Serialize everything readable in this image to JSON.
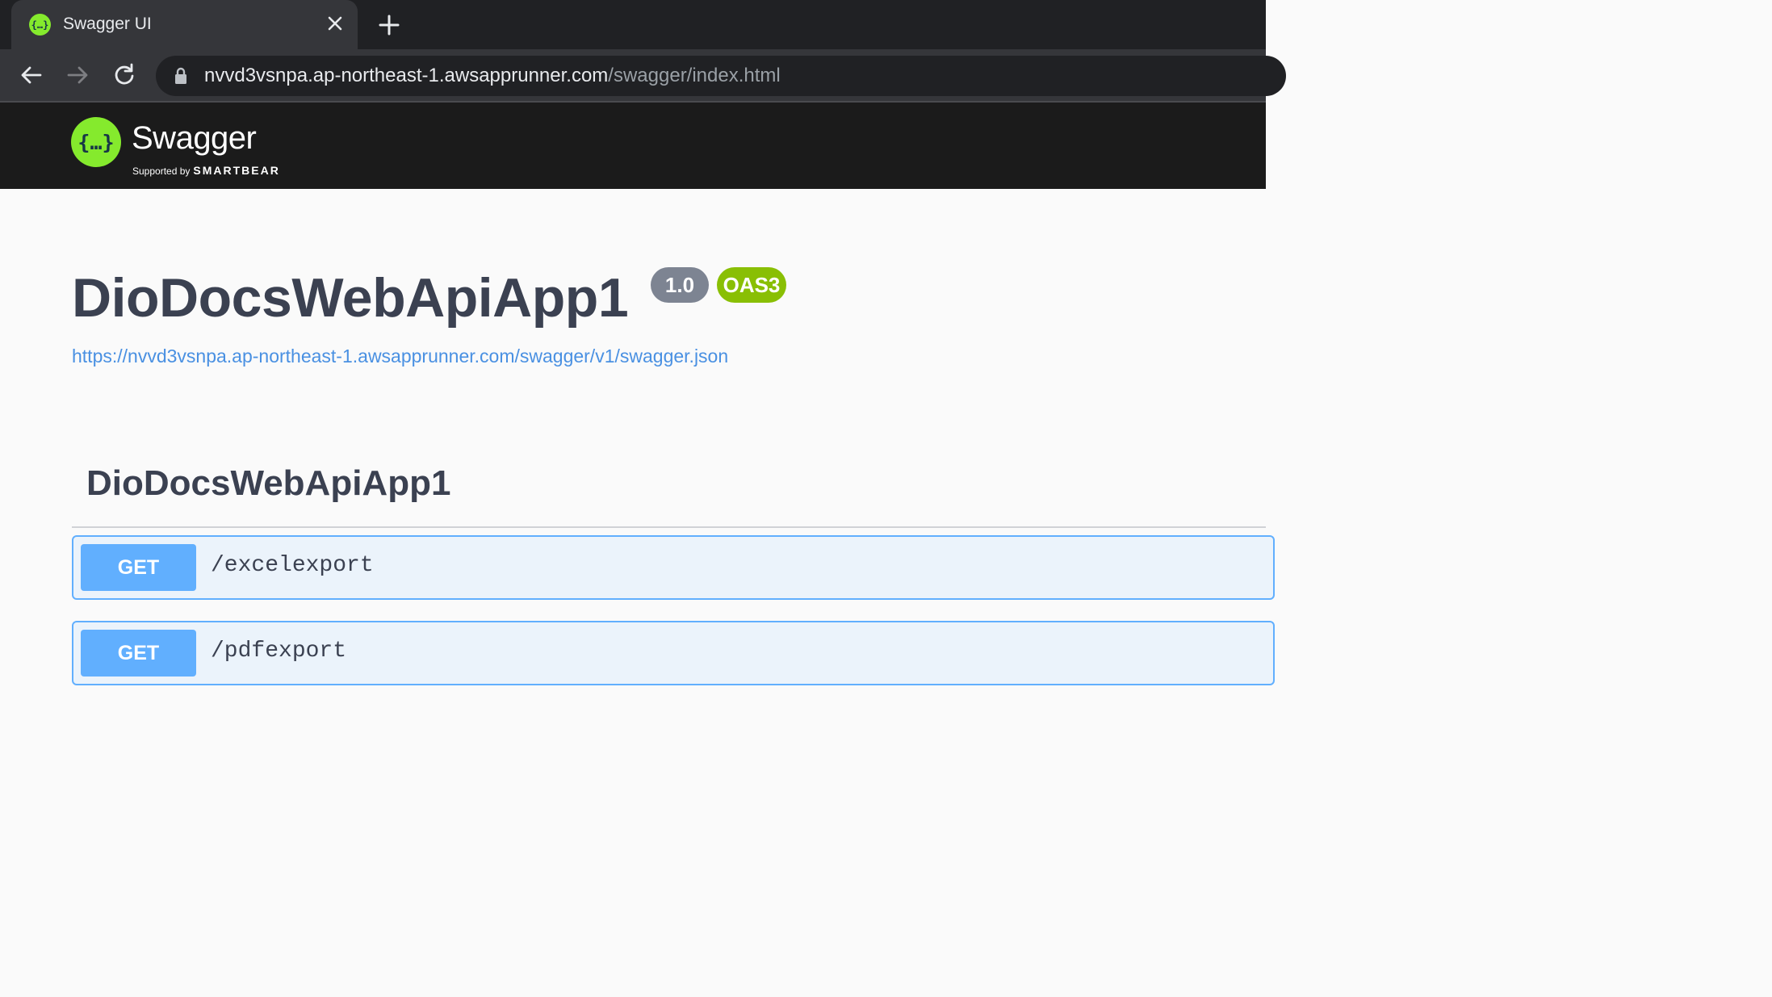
{
  "browser": {
    "tab_title": "Swagger UI",
    "url_host": "nvvd3vsnpa.ap-northeast-1.awsapprunner.com",
    "url_path": "/swagger/index.html"
  },
  "header": {
    "brand": "Swagger",
    "supported_by": "Supported by",
    "company": "SMARTBEAR"
  },
  "info": {
    "title": "DioDocsWebApiApp1",
    "version": "1.0",
    "oas": "OAS3",
    "spec_url": "https://nvvd3vsnpa.ap-northeast-1.awsapprunner.com/swagger/v1/swagger.json"
  },
  "tag": {
    "name": "DioDocsWebApiApp1"
  },
  "operations": [
    {
      "method": "GET",
      "path": "/excelexport"
    },
    {
      "method": "GET",
      "path": "/pdfexport"
    }
  ],
  "colors": {
    "get": "#61affe",
    "swagger_green": "#85ea2d",
    "oas_badge": "#89bf04",
    "version_badge": "#7d8492",
    "link": "#4990e2"
  }
}
